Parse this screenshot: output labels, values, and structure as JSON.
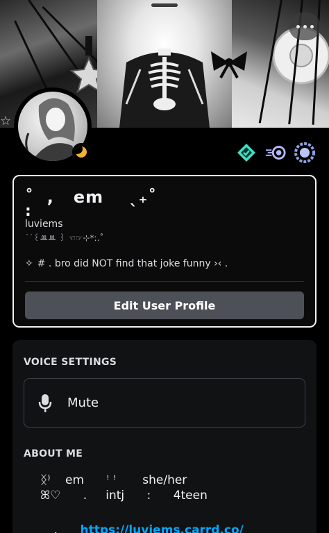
{
  "banner": {
    "more_icon": "more-horizontal-icon"
  },
  "avatar": {
    "status": "idle",
    "status_color": "#f0b232"
  },
  "badges": [
    {
      "name": "hypesquad-balance-icon",
      "color": "#45ddc0"
    },
    {
      "name": "nitro-boost-icon",
      "color": "#b9bbff"
    },
    {
      "name": "quest-laurel-icon",
      "color": "#8ea1e1"
    }
  ],
  "profile": {
    "display_name": "˚  ,   em    ˎ₊˚",
    "display_name_sub": ":",
    "username": "luviems",
    "pronoun_line": "˙˙꒰ꔛꔛ ꒱ ☜☞⊹*:.˚",
    "status_symbol": "✧",
    "status_text": "#  . bro did NOT find that joke funny ›‹ .",
    "edit_button": "Edit User Profile"
  },
  "voice_settings": {
    "title": "VOICE SETTINGS",
    "mute_label": "Mute",
    "mic_icon": "microphone-icon"
  },
  "about_me": {
    "title": "ABOUT ME",
    "line1": "ᛝ⁾    em      ꜝ ꜝ       she/her",
    "line2": "ꕤ♡      .     intj      :      4teen",
    "line3_prefix": ".",
    "link": "https://luviems.carrd.co/"
  },
  "colors": {
    "accent_link": "#00a8fc",
    "button_bg": "#4e5058",
    "card_bg": "#111214"
  }
}
